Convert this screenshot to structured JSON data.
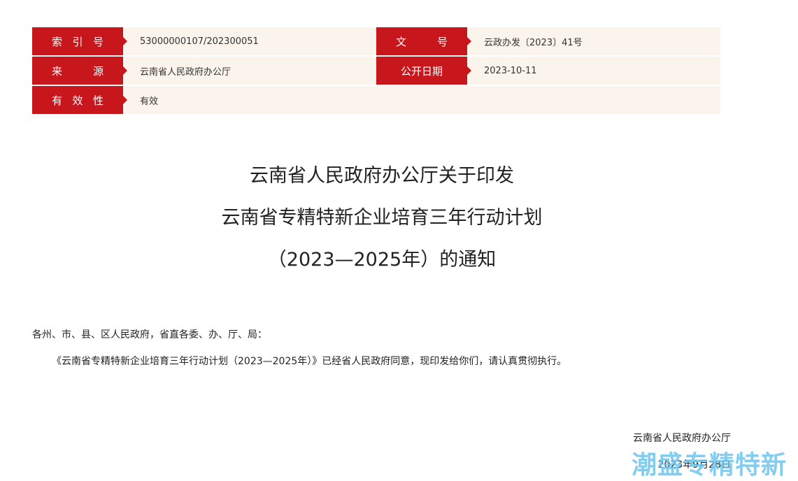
{
  "meta": {
    "row1": {
      "left_label": "索 引 号",
      "left_value": "53000000107/202300051",
      "right_label": "文    号",
      "right_value": "云政办发〔2023〕41号"
    },
    "row2": {
      "left_label": "来    源",
      "left_value": "云南省人民政府办公厅",
      "right_label": "公开日期",
      "right_value": "2023-10-11"
    },
    "row3": {
      "left_label": "有 效 性",
      "left_value": "有效"
    }
  },
  "document": {
    "title_lines": [
      "云南省人民政府办公厅关于印发",
      "云南省专精特新企业培育三年行动计划",
      "（2023—2025年）的通知"
    ],
    "addressee": "各州、市、县、区人民政府，省直各委、办、厅、局：",
    "body": "《云南省专精特新企业培育三年行动计划（2023—2025年）》已经省人民政府同意，现印发给你们，请认真贯彻执行。",
    "signature_org": "云南省人民政府办公厅",
    "signature_date": "2023年9月28日"
  },
  "watermark": {
    "text": "潮盛专精特新",
    "color": "#6ec6ee"
  },
  "colors": {
    "label_bg": "#c8161d",
    "value_bg": "#faf4ec"
  }
}
